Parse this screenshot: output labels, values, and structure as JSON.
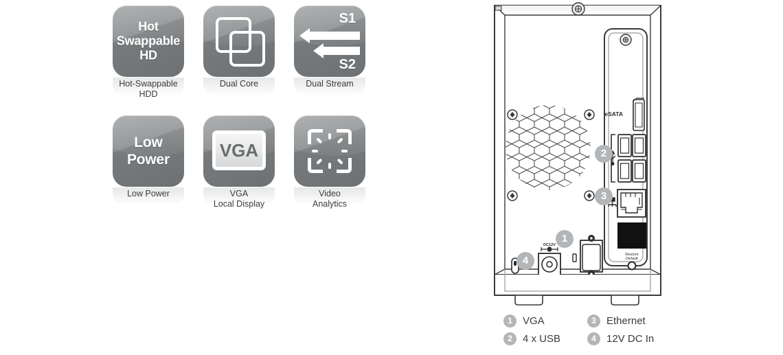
{
  "features": [
    {
      "id": "hot-swappable-hd",
      "tile_lines": [
        "Hot",
        "Swappable",
        "HD"
      ],
      "caption": "Hot-Swappable\nHDD",
      "icon": "text-badge-icon"
    },
    {
      "id": "dual-core",
      "tile_lines": [],
      "caption": "Dual Core",
      "icon": "overlapping-squares-icon"
    },
    {
      "id": "dual-stream",
      "tile_lines": [
        "S1",
        "S2"
      ],
      "caption": "Dual Stream",
      "icon": "dual-arrows-icon"
    },
    {
      "id": "low-power",
      "tile_lines": [
        "Low",
        "Power"
      ],
      "caption": "Low Power",
      "icon": "text-badge-icon"
    },
    {
      "id": "vga-local-display",
      "tile_lines": [
        "VGA"
      ],
      "caption": "VGA\nLocal Display",
      "icon": "monitor-icon"
    },
    {
      "id": "video-analytics",
      "tile_lines": [],
      "caption": "Video\nAnalytics",
      "icon": "focus-brackets-icon"
    }
  ],
  "feature_labels": {
    "hot_swappable_hd_line1": "Hot",
    "hot_swappable_hd_line2": "Swappable",
    "hot_swappable_hd_line3": "HD",
    "hot_swappable_caption_line1": "Hot-Swappable",
    "hot_swappable_caption_line2": "HDD",
    "dual_core_caption": "Dual Core",
    "dual_stream_s1": "S1",
    "dual_stream_s2": "S2",
    "dual_stream_caption": "Dual Stream",
    "low_power_line1": "Low",
    "low_power_line2": "Power",
    "low_power_caption": "Low Power",
    "vga_tile_text": "VGA",
    "vga_caption_line1": "VGA",
    "vga_caption_line2": "Local Display",
    "video_analytics_caption_line1": "Video",
    "video_analytics_caption_line2": "Analytics"
  },
  "device": {
    "title": "rear-panel-diagram",
    "port_labels": {
      "esata": "eSATA",
      "dc_in": "DC12V",
      "restore_line1": "Restore",
      "restore_line2": "Default"
    },
    "callouts": [
      {
        "number": "1",
        "target": "vga-port"
      },
      {
        "number": "2",
        "target": "usb-ports"
      },
      {
        "number": "3",
        "target": "ethernet-port"
      },
      {
        "number": "4",
        "target": "dc-in-jack"
      }
    ]
  },
  "legend": {
    "rows": [
      [
        {
          "number": "1",
          "label": "VGA"
        },
        {
          "number": "3",
          "label": "Ethernet"
        }
      ],
      [
        {
          "number": "2",
          "label": "4 x USB"
        },
        {
          "number": "4",
          "label": "12V DC In"
        }
      ]
    ],
    "items": {
      "n1": "1",
      "l1": "VGA",
      "n2": "2",
      "l2": "4 x USB",
      "n3": "3",
      "l3": "Ethernet",
      "n4": "4",
      "l4": "12V DC In"
    }
  },
  "colors": {
    "tile_gray_light": "#9a9d9f",
    "tile_gray_dark": "#6e7173",
    "caption_text": "#3b3b3b",
    "callout_gray": "#b3b6b8",
    "line_stroke": "#3a3a3a"
  }
}
